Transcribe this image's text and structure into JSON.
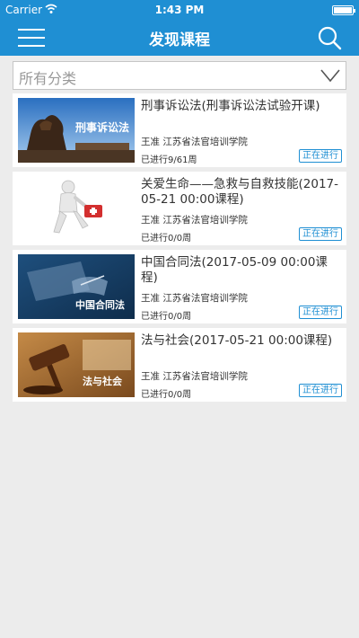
{
  "status_bar": {
    "carrier": "Carrier",
    "time": "1:43 PM"
  },
  "header": {
    "title": "发现课程",
    "menu_icon": "hamburger-menu-icon",
    "search_icon": "search-icon"
  },
  "filter": {
    "selected": "所有分类",
    "icon": "chevron-down-icon"
  },
  "theme": {
    "primary": "#1f8fd3",
    "background": "#ececec"
  },
  "courses": [
    {
      "title": "刑事诉讼法(刑事诉讼法试验开课)",
      "thumb_caption": "刑事诉讼法",
      "teacher": "王准 江苏省法官培训学院",
      "progress": "已进行9/61周",
      "status": "正在进行"
    },
    {
      "title": "关爱生命——急救与自救技能(2017-05-21 00:00课程)",
      "thumb_caption": "",
      "teacher": "王准 江苏省法官培训学院",
      "progress": "已进行0/0周",
      "status": "正在进行"
    },
    {
      "title": "中国合同法(2017-05-09 00:00课程)",
      "thumb_caption": "中国合同法",
      "teacher": "王准 江苏省法官培训学院",
      "progress": "已进行0/0周",
      "status": "正在进行"
    },
    {
      "title": "法与社会(2017-05-21 00:00课程)",
      "thumb_caption": "法与社会",
      "teacher": "王准 江苏省法官培训学院",
      "progress": "已进行0/0周",
      "status": "正在进行"
    }
  ]
}
